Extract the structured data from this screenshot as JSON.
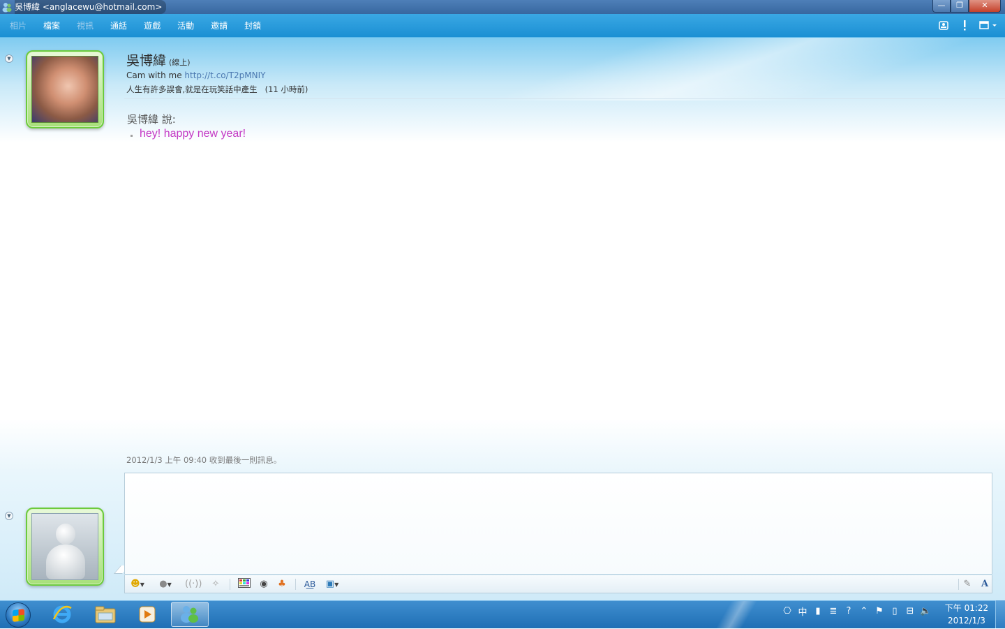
{
  "window": {
    "title": "吳博緯 <anglacewu@hotmail.com>",
    "buttons": {
      "minimize": "—",
      "maximize": "❐",
      "close": "✕"
    }
  },
  "menu": {
    "items": [
      {
        "label": "相片",
        "enabled": false
      },
      {
        "label": "檔案",
        "enabled": true
      },
      {
        "label": "視訊",
        "enabled": false
      },
      {
        "label": "通話",
        "enabled": true
      },
      {
        "label": "遊戲",
        "enabled": true
      },
      {
        "label": "活動",
        "enabled": true
      },
      {
        "label": "邀請",
        "enabled": true
      },
      {
        "label": "封鎖",
        "enabled": true
      }
    ],
    "right_icons": [
      "contact-card-icon",
      "alert-icon",
      "layout-menu-icon"
    ]
  },
  "contact": {
    "name": "吳博緯",
    "status": "(線上)",
    "psm_prefix": "Cam with me ",
    "psm_link": "http://t.co/T2pMNIY",
    "now_playing": "人生有許多誤會,就是在玩笑話中產生",
    "now_playing_time": "(11 小時前)"
  },
  "conversation": {
    "sender_line": "吳博緯 說:",
    "messages": [
      {
        "text": "hey! happy new year!",
        "color": "#c438c4"
      }
    ],
    "last_received": "2012/1/3 上午 09:40 收到最後一則訊息。"
  },
  "input": {
    "value": "",
    "toolbar_icons": [
      "emoticon-icon",
      "wink-icon",
      "nudge-icon",
      "voice-clip-icon",
      "background-icon",
      "send-file-icon",
      "games-icon",
      "spellcheck-icon",
      "activity-icon",
      "handwriting-icon",
      "font-icon"
    ]
  },
  "taskbar": {
    "apps": [
      "internet-explorer-icon",
      "file-explorer-icon",
      "media-player-icon",
      "windows-live-messenger-icon"
    ],
    "tray": {
      "ime": "中"
    },
    "clock": {
      "time": "下午 01:22",
      "date": "2012/1/3"
    }
  }
}
